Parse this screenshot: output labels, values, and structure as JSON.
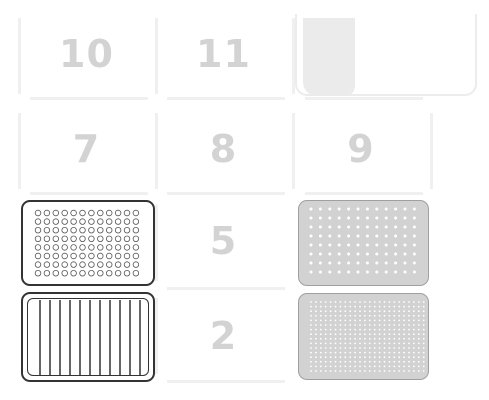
{
  "deck": {
    "slot_labels": {
      "slot_10": "10",
      "slot_11": "11",
      "slot_7": "7",
      "slot_8": "8",
      "slot_9": "9",
      "slot_5": "5",
      "slot_2": "2"
    },
    "colors": {
      "slot_number": "#d3d3d3",
      "labware_border": "#333333",
      "labware_grey": "#d2d2d2",
      "well_dot": "#ffffff"
    },
    "labware": [
      {
        "slot": "4",
        "type": "96-well-plate",
        "icon": "well-plate-icon"
      },
      {
        "slot": "1",
        "type": "12-channel-reservoir",
        "icon": "reservoir-icon"
      },
      {
        "slot": "6",
        "type": "tip-rack",
        "icon": "tip-rack-icon"
      },
      {
        "slot": "3",
        "type": "tip-rack",
        "icon": "tip-rack-icon"
      }
    ]
  }
}
